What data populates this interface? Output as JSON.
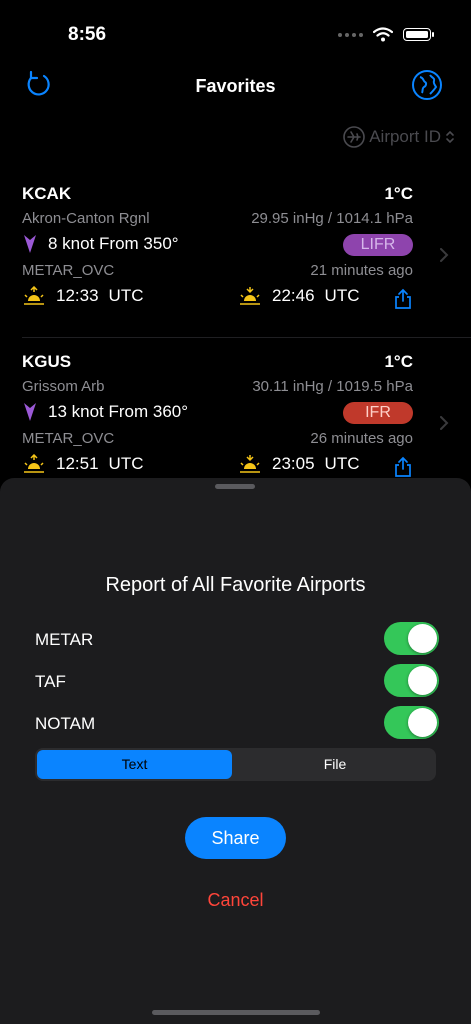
{
  "status": {
    "time": "8:56"
  },
  "header": {
    "title": "Favorites",
    "left_icon": "refresh-icon",
    "right_icon": "globe-icon"
  },
  "sort": {
    "label": "Airport ID",
    "icon": "airplane-icon"
  },
  "airports": [
    {
      "code": "KCAK",
      "temp": "1°C",
      "name": "Akron-Canton Rgnl",
      "pressure": "29.95 inHg / 1014.1 hPa",
      "wind": "8 knot From 350°",
      "category": "LIFR",
      "category_color": "#8e44ad",
      "category_text_color": "#d6b6ea",
      "metar": "METAR_OVC",
      "age": "21 minutes ago",
      "sunrise": "12:33",
      "sunset": "22:46",
      "tz": "UTC"
    },
    {
      "code": "KGUS",
      "temp": "1°C",
      "name": "Grissom Arb",
      "pressure": "30.11 inHg / 1019.5 hPa",
      "wind": "13 knot From 360°",
      "category": "IFR",
      "category_color": "#c0392b",
      "category_text_color": "#ffd0c8",
      "metar": "METAR_OVC",
      "age": "26 minutes ago",
      "sunrise": "12:51",
      "sunset": "23:05",
      "tz": "UTC"
    }
  ],
  "sheet": {
    "title": "Report of All Favorite Airports",
    "toggles": [
      {
        "label": "METAR",
        "on": true
      },
      {
        "label": "TAF",
        "on": true
      },
      {
        "label": "NOTAM",
        "on": true
      }
    ],
    "format_options": [
      "Text",
      "File"
    ],
    "selected_format": "Text",
    "share_label": "Share",
    "cancel_label": "Cancel"
  },
  "colors": {
    "accent": "#0a84ff",
    "toggle_on": "#34c759",
    "destructive": "#ff453a",
    "sun": "#f5c518",
    "wind": "#9b59d6"
  }
}
